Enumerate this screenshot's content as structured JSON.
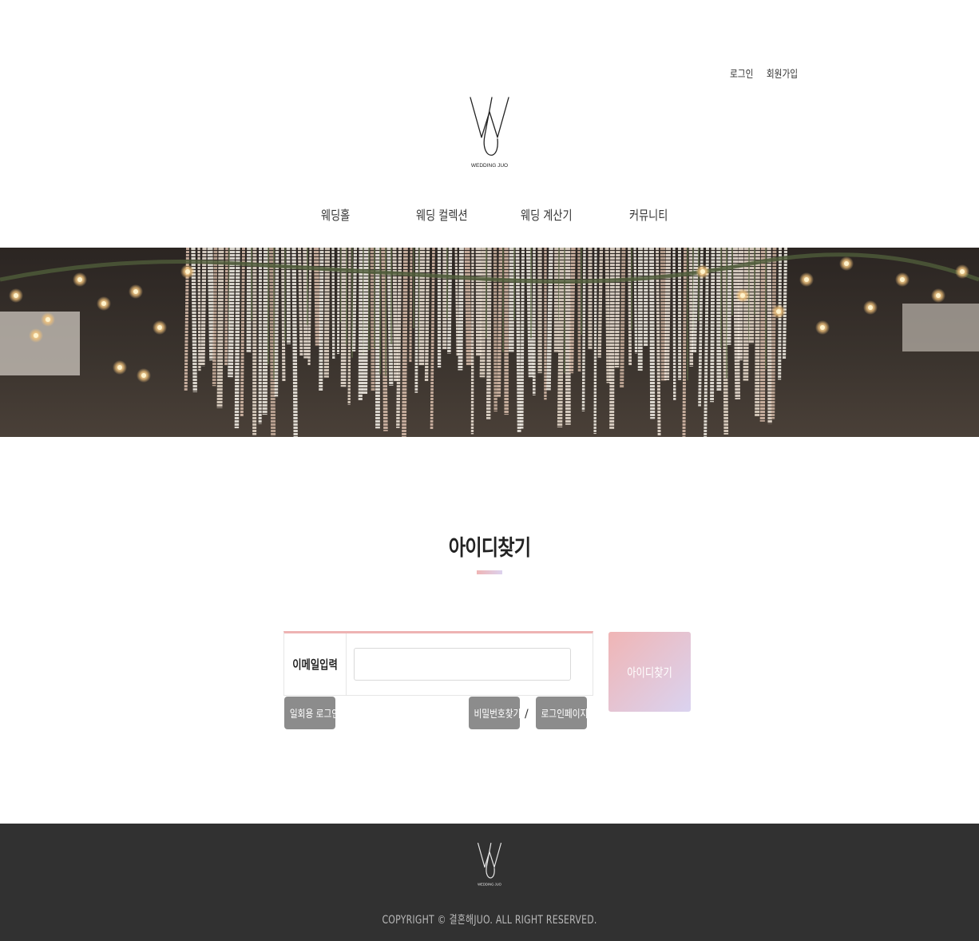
{
  "header": {
    "links": {
      "login": "로그인",
      "signup": "회원가입"
    },
    "logo_text": "WEDDING JUO"
  },
  "nav": {
    "items": [
      {
        "label": "웨딩홀"
      },
      {
        "label": "웨딩 컬렉션"
      },
      {
        "label": "웨딩 계산기"
      },
      {
        "label": "커뮤니티"
      }
    ]
  },
  "find_id": {
    "title": "아이디찾기",
    "email_label": "이메일입력",
    "email_value": "",
    "email_placeholder": "",
    "submit_label": "아이디찾기",
    "guest_login_label": "일회용 로그인",
    "find_password_label": "비밀번호찾기",
    "separator": "/",
    "login_page_label": "로그인페이지"
  },
  "footer": {
    "logo_text": "WEDDING JUO",
    "copyright": "COPYRIGHT © 결혼해JUO. ALL RIGHT RESERVED."
  },
  "colors": {
    "accent_pink": "#efb5b5",
    "accent_lavender": "#dcd2ee",
    "button_gray": "#8c8c8c",
    "footer_bg": "#313131"
  }
}
